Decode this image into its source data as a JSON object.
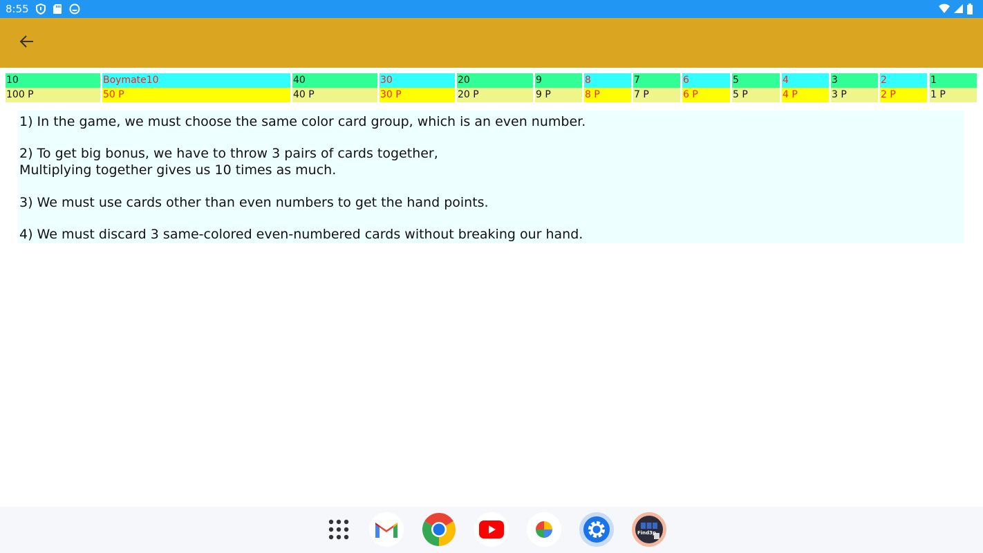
{
  "status_bar": {
    "time": "8:55"
  },
  "app_bar": {
    "back_icon": "back-arrow-icon"
  },
  "score_table": {
    "columns": [
      {
        "name": "10",
        "points": "100 P"
      },
      {
        "name": "Boymate10",
        "points": "50 P"
      },
      {
        "name": "40",
        "points": "40 P"
      },
      {
        "name": "30",
        "points": "30 P"
      },
      {
        "name": "20",
        "points": "20 P"
      },
      {
        "name": "9",
        "points": "9 P"
      },
      {
        "name": "8",
        "points": "8 P"
      },
      {
        "name": "7",
        "points": "7 P"
      },
      {
        "name": "6",
        "points": "6 P"
      },
      {
        "name": "5",
        "points": "5 P"
      },
      {
        "name": "4",
        "points": "4 P"
      },
      {
        "name": "3",
        "points": "3 P"
      },
      {
        "name": "2",
        "points": "2 P"
      },
      {
        "name": "1",
        "points": "1 P"
      }
    ]
  },
  "rules": {
    "rule1": "1) In the game, we must choose the same color card group, which is an even number.",
    "rule2_line1": "2) To get big bonus, we have to throw 3 pairs of cards together,",
    "rule2_line2": "Multiplying together gives us 10 times as much.",
    "rule3": "3) We must use cards other than even numbers to get the hand points.",
    "rule4": "4) We must discard 3 same-colored even-numbered cards without breaking our hand."
  },
  "dock": {
    "apps": [
      "app-drawer-icon",
      "gmail-icon",
      "chrome-icon",
      "youtube-icon",
      "photos-icon",
      "settings-icon",
      "find-app-icon"
    ],
    "find_app_label": "Find3p"
  },
  "colors": {
    "status_bar": "#2196f3",
    "app_bar": "#daa520",
    "green_cell": "#33ff99",
    "cyan_cell": "#33ffff",
    "pale_yellow_cell": "#eef58a",
    "yellow_cell": "#ffff00",
    "red_text": "#ff2020",
    "rules_bg": "#eeffff"
  }
}
